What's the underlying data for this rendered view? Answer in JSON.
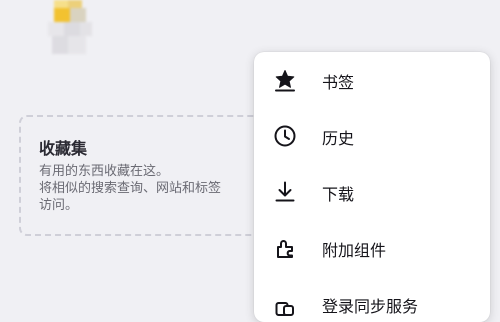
{
  "collections": {
    "title": "收藏集",
    "description_lines": [
      "有用的东西收藏在这。",
      "将相似的搜索查询、网站和标签",
      "访问。"
    ]
  },
  "menu": {
    "items": [
      {
        "label": "书签",
        "icon": "star-icon"
      },
      {
        "label": "历史",
        "icon": "clock-icon"
      },
      {
        "label": "下载",
        "icon": "download-icon"
      },
      {
        "label": "附加组件",
        "icon": "puzzle-icon"
      },
      {
        "label": "登录同步服务",
        "icon": "sync-device-icon"
      }
    ]
  },
  "colors": {
    "background": "#f0f0f4",
    "menu_background": "#ffffff",
    "text_primary": "#15141a",
    "text_secondary": "#6a6a73",
    "thumbnail_accent": "#f2c230"
  }
}
